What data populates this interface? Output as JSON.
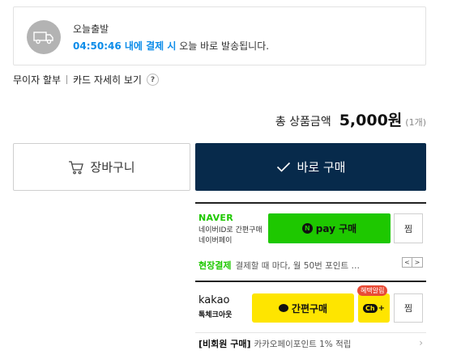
{
  "delivery": {
    "title": "오늘출발",
    "timer": "04:50:46 내에 결제 시",
    "message": " 오늘 바로 발송됩니다.",
    "icon": "truck-icon"
  },
  "card": {
    "installment": "무이자 할부",
    "details": "카드 자세히 보기",
    "help": "?"
  },
  "total": {
    "label": "총 상품금액",
    "price": "5,000원",
    "qty": "(1개)"
  },
  "actions": {
    "cart_label": "장바구니",
    "buy_label": "바로 구매"
  },
  "naver": {
    "logo": "NAVER",
    "sub1": "네이버ID로 간편구매",
    "sub2": "네이버페이",
    "npay_n": "N",
    "npay_label": "pay 구매",
    "zzim": "찜",
    "info_green": "현장결제",
    "info_text": "결제할 때 마다, 월 50번 포인트 …",
    "prev": "<",
    "next": ">"
  },
  "kakao": {
    "logo": "kakao",
    "sub": "톡체크아웃",
    "buy_label": "간편구매",
    "badge": "혜택알림",
    "ch_label": "Ch",
    "ch_plus": "+",
    "zzim": "찜",
    "info_bold": "[비회원 구매]",
    "info_text": "카카오페이포인트 1% 적립",
    "chevron": "›"
  },
  "colors": {
    "accent_blue": "#0c8ce9",
    "buy_navy": "#072a4b",
    "naver_green": "#1ec800",
    "kakao_yellow": "#fee500",
    "badge_red": "#e94b35"
  }
}
